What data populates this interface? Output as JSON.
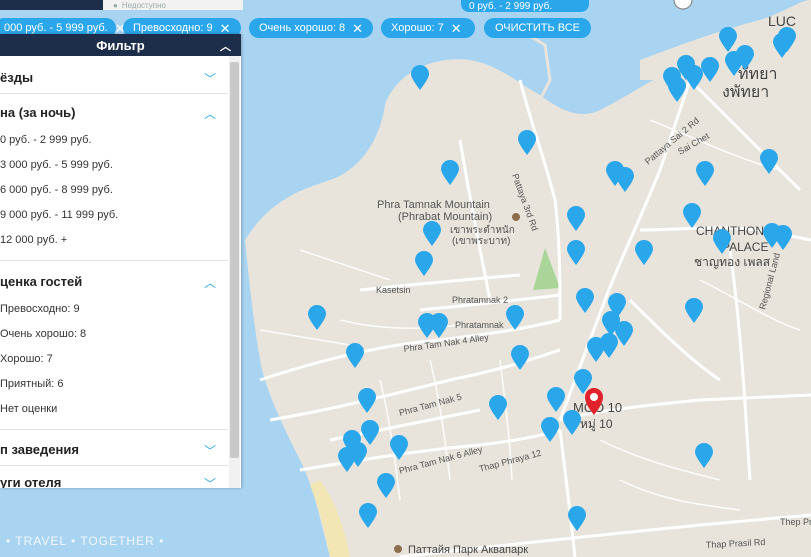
{
  "top": {
    "disabled_tab": "Недоступно",
    "price_chip": "0 руб. - 2 999 руб."
  },
  "chips": [
    {
      "label": "000 руб. - 5 999 руб."
    },
    {
      "label": "Превосходно: 9"
    },
    {
      "label": "Очень хорошо: 8"
    },
    {
      "label": "Хорошо: 7"
    },
    {
      "label": "ОЧИСТИТЬ ВСЕ"
    }
  ],
  "panel": {
    "title": "Фильтр",
    "sections": [
      {
        "label": "ёзды"
      },
      {
        "label": "на (за ночь)",
        "options": [
          "0 руб. - 2 999 руб.",
          "3 000 руб. - 5 999 руб.",
          "6 000 руб. - 8 999 руб.",
          "9 000 руб. - 11 999 руб.",
          "12 000 руб. +"
        ]
      },
      {
        "label": "ценка гостей",
        "options": [
          "Превосходно: 9",
          "Очень хорошо: 8",
          "Хорошо: 7",
          "Приятный: 6",
          "Нет оценки"
        ]
      },
      {
        "label": "п заведения"
      },
      {
        "label": "уги отеля"
      }
    ]
  },
  "map": {
    "labels": {
      "mountain_1": "Phra Tamnak Mountain",
      "mountain_2": "(Phrabat Mountain)",
      "mountain_thai_1": "เขาพระตำหนัก",
      "mountain_thai_2": "(เขาพระบาท)",
      "kasetsin": "Kasetsin",
      "phratamnak2": "Phratamnak 2",
      "phratamnak": "Phratamnak",
      "tam_nak_4": "Phra Tam Nak 4 Alley",
      "tam_nak_5": "Phra Tam Nak 5",
      "tam_nak_6": "Phra Tam Nak 6 Alley",
      "thap_phraya": "Thap Phraya 12",
      "moo10": "MOO 10",
      "moo10_thai": "หมู่ 10",
      "chanthong": "CHANTHONG",
      "palace": "PALACE",
      "chanthong_thai": "ชาญทอง เพลส",
      "regional": "Regional Land",
      "pattaya_3rd": "Pattaya 3rd Rd",
      "pattaya_sai2": "Pattaya Sai 2 Rd",
      "soi_chet": "Sai Chet",
      "pattaya_thai": "ทัทยา",
      "pattaya_thai2": "งพัทยา",
      "lucky": "LUC",
      "aquapark": "Паттайя Парк Аквапарк",
      "prasil": "Thap Prasil Rd",
      "thepprasit": "Thep Prasit Rd"
    }
  },
  "watermark": "• TRAVEL • TOGETHER •",
  "colors": {
    "accent": "#2aa6ea",
    "panel_header": "#1d2e4a",
    "water": "#a8d4f2",
    "land": "#e8e4dc",
    "selected_marker": "#e0232b",
    "park": "#a9d598"
  }
}
